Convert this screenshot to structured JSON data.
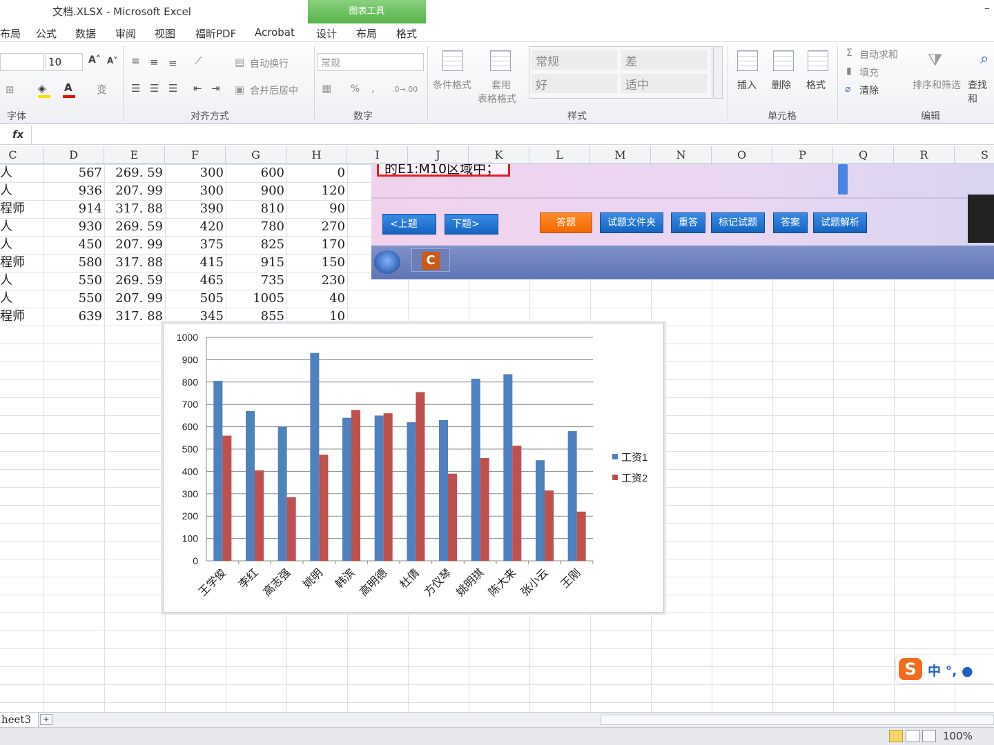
{
  "window": {
    "title": "文档.XLSX - Microsoft Excel",
    "context_group": "图表工具",
    "minimize_glyph": "–"
  },
  "ribbon_tabs": [
    "布局",
    "公式",
    "数据",
    "审阅",
    "视图",
    "福昕PDF",
    "Acrobat",
    "设计",
    "布局",
    "格式"
  ],
  "ribbon": {
    "font": {
      "size": "10",
      "group_label": "字体"
    },
    "alignment": {
      "wrap": "自动换行",
      "merge": "合并后居中",
      "group_label": "对齐方式"
    },
    "number": {
      "format": "常规",
      "percent": "%",
      "comma": ",",
      "group_label": "数字"
    },
    "styles": {
      "conditional": "条件格式",
      "table": "套用",
      "table2": "表格格式",
      "cells": [
        "常规",
        "差",
        "好",
        "适中"
      ],
      "group_label": "样式"
    },
    "cells": {
      "insert": "插入",
      "delete": "删除",
      "format": "格式",
      "group_label": "单元格"
    },
    "editing": {
      "autosum": "自动求和",
      "fill": "填充",
      "clear": "清除",
      "sort": "排序和筛选",
      "find": "查找和",
      "group_label": "编辑"
    }
  },
  "formula_bar": {
    "fx": "fx"
  },
  "columns": [
    "C",
    "D",
    "E",
    "F",
    "G",
    "H",
    "I",
    "J",
    "K",
    "L",
    "M",
    "N",
    "O",
    "P",
    "Q",
    "R",
    "S"
  ],
  "rows": [
    [
      "人",
      "567",
      "269. 59",
      "300",
      "600",
      "0"
    ],
    [
      "人",
      "936",
      "207. 99",
      "300",
      "900",
      "120"
    ],
    [
      "程师",
      "914",
      "317. 88",
      "390",
      "810",
      "90"
    ],
    [
      "人",
      "930",
      "269. 59",
      "420",
      "780",
      "270"
    ],
    [
      "人",
      "450",
      "207. 99",
      "375",
      "825",
      "170"
    ],
    [
      "程师",
      "580",
      "317. 88",
      "415",
      "915",
      "150"
    ],
    [
      "人",
      "550",
      "269. 59",
      "465",
      "735",
      "230"
    ],
    [
      "人",
      "550",
      "207. 99",
      "505",
      "1005",
      "40"
    ],
    [
      "程师",
      "639",
      "317. 88",
      "345",
      "855",
      "10"
    ]
  ],
  "overlay": {
    "question_text": "的E1:M10区域中；",
    "buttons": [
      "<上题",
      "下题>",
      "答题",
      "试题文件夹",
      "重答",
      "标记试题",
      "答案",
      "试题解析"
    ],
    "app_icon": "C"
  },
  "chart_data": {
    "type": "bar",
    "categories": [
      "王学俊",
      "李红",
      "高志强",
      "姚明",
      "韩滨",
      "高明德",
      "杜倩",
      "方仪琴",
      "姚明琪",
      "陈大来",
      "张小云",
      "王刚"
    ],
    "series": [
      {
        "name": "工资1",
        "color": "#4f81bd",
        "values": [
          805,
          670,
          600,
          930,
          640,
          650,
          620,
          630,
          815,
          835,
          450,
          580
        ]
      },
      {
        "name": "工资2",
        "color": "#c0504d",
        "values": [
          560,
          405,
          285,
          475,
          675,
          660,
          755,
          390,
          460,
          515,
          315,
          220
        ]
      }
    ],
    "ylim": [
      0,
      1000
    ],
    "yticks": [
      0,
      100,
      200,
      300,
      400,
      500,
      600,
      700,
      800,
      900,
      1000
    ],
    "grid": true,
    "legend": "right"
  },
  "sheet": {
    "tab_label": "heet3"
  },
  "status": {
    "zoom": "100%"
  }
}
